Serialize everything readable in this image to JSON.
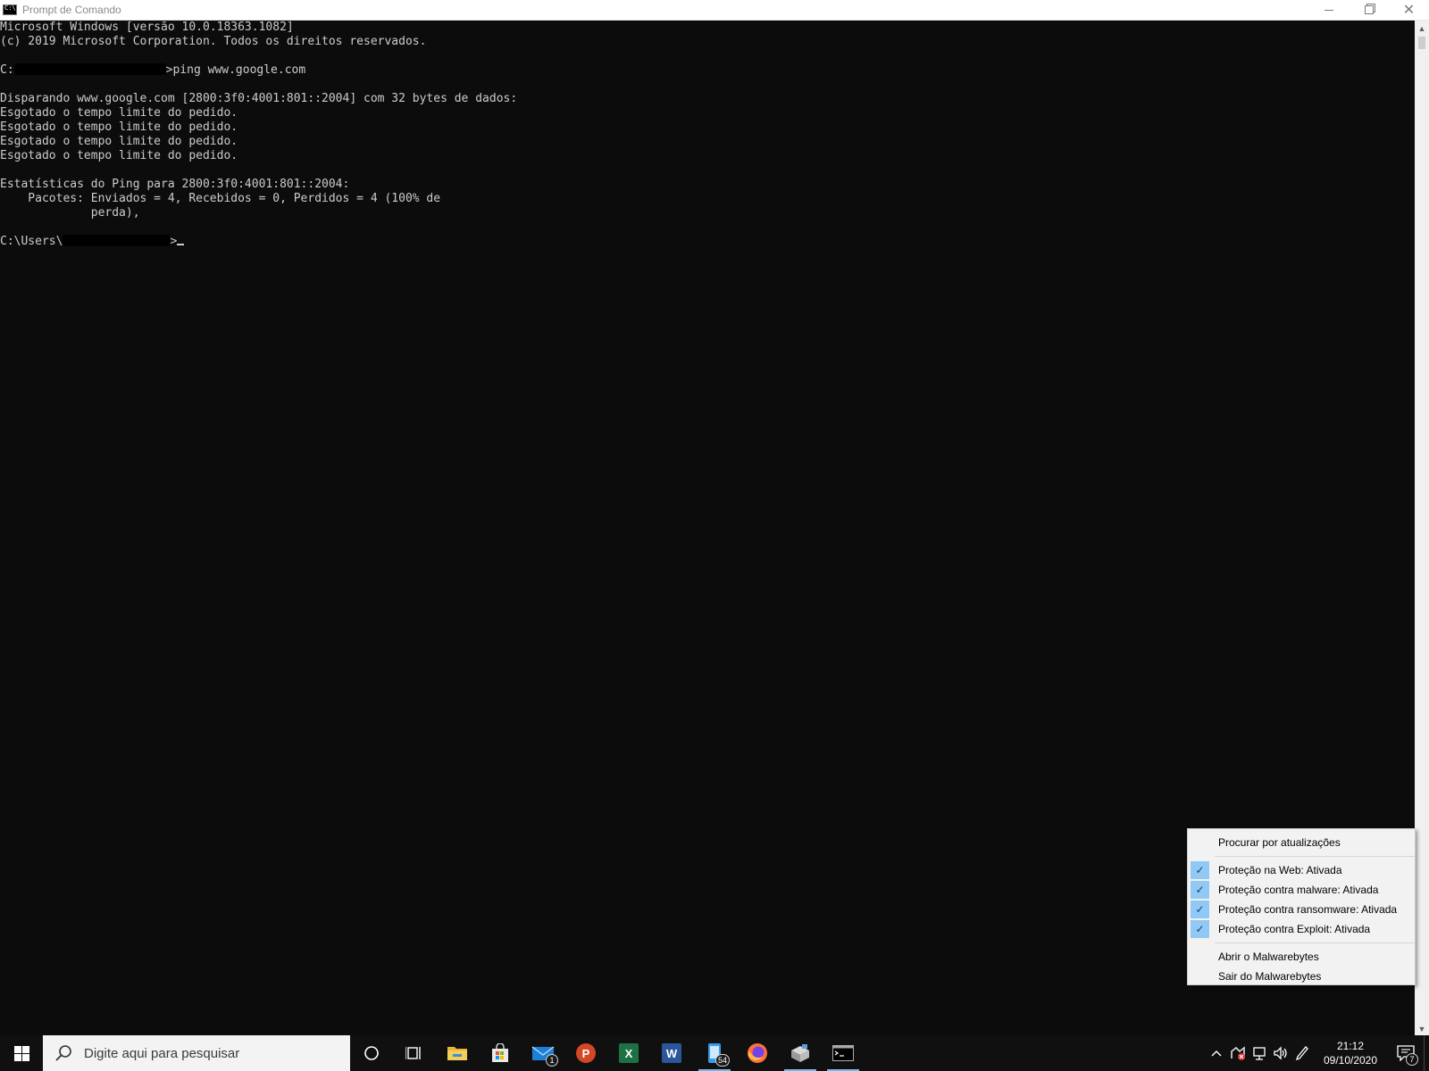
{
  "window": {
    "title": "Prompt de Comando",
    "icon": "cmd-icon",
    "controls": {
      "minimize": "minimize-icon",
      "maximize": "maximize-icon",
      "close": "✕"
    }
  },
  "console": {
    "line1": "Microsoft Windows [versão 10.0.18363.1082]",
    "line2": "(c) 2019 Microsoft Corporation. Todos os direitos reservados.",
    "prompt1_prefix": "C:",
    "command1": ">ping www.google.com",
    "line4": "Disparando www.google.com [2800:3f0:4001:801::2004] com 32 bytes de dados:",
    "timeouts": [
      "Esgotado o tempo limite do pedido.",
      "Esgotado o tempo limite do pedido.",
      "Esgotado o tempo limite do pedido.",
      "Esgotado o tempo limite do pedido."
    ],
    "stats_title": "Estatísticas do Ping para 2800:3f0:4001:801::2004:",
    "stats_line1": "    Pacotes: Enviados = 4, Recebidos = 0, Perdidos = 4 (100% de",
    "stats_line2": "             perda),",
    "prompt2_prefix": "C:\\Users\\",
    "prompt2_suffix": ">"
  },
  "context_menu": {
    "check_updates": "Procurar por atualizações",
    "items": [
      {
        "label": "Proteção na Web: Ativada",
        "checked": true
      },
      {
        "label": "Proteção contra malware: Ativada",
        "checked": true
      },
      {
        "label": "Proteção contra ransomware: Ativada",
        "checked": true
      },
      {
        "label": "Proteção contra Exploit: Ativada",
        "checked": true
      }
    ],
    "open": "Abrir o Malwarebytes",
    "exit": "Sair do Malwarebytes"
  },
  "taskbar": {
    "search_placeholder": "Digite aqui para pesquisar",
    "apps": {
      "mail_badge": "1",
      "powerpoint_letter": "P",
      "excel_letter": "X",
      "word_letter": "W",
      "phone_badge": "54"
    },
    "clock_time": "21:12",
    "clock_date": "09/10/2020",
    "notification_count": "7"
  },
  "colors": {
    "console_bg": "#0c0c0c",
    "console_text": "#cccccc",
    "taskbar_bg": "#101010",
    "powerpoint": "#d24726",
    "excel": "#1e7145",
    "word": "#2b579a",
    "menu_check": "#90c8f6"
  }
}
